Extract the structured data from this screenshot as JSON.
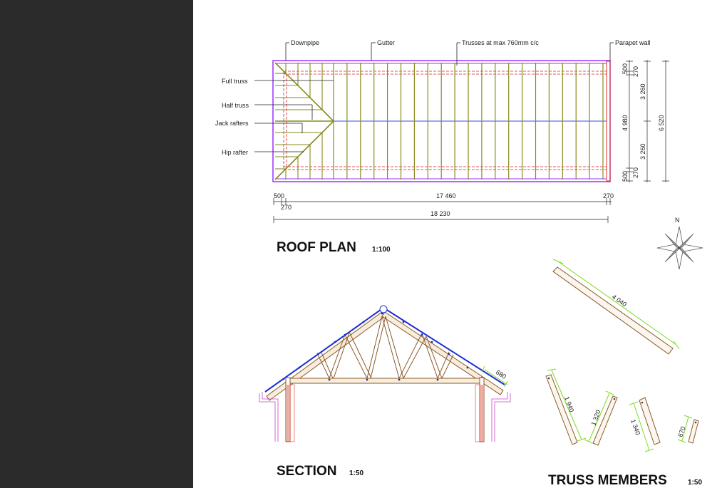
{
  "colors": {
    "background": "#2b2b2b",
    "sheet": "#ffffff",
    "truss": "#8a8a1e",
    "timber": "#8b5a2b",
    "outline": "#9b30ff",
    "dashed": "#d62020",
    "ridge": "#3050e0",
    "dimension_green": "#7ddc1f",
    "roof_blue": "#1a2fd6"
  },
  "roof_plan": {
    "title": "ROOF PLAN",
    "scale": "1:100",
    "callouts": {
      "downpipe": "Downpipe",
      "gutter": "Gutter",
      "trusses": "Trusses at max 760mm c/c",
      "parapet": "Parapet wall",
      "full_truss": "Full truss",
      "half_truss": "Half truss",
      "jack_rafters": "Jack rafters",
      "hip_rafter": "Hip rafter"
    },
    "dimensions": {
      "bottom_500": "500",
      "bottom_270_left": "270",
      "bottom_17460": "17 460",
      "bottom_270_right": "270",
      "overall_18230": "18 230",
      "right_500_top": "500",
      "right_270_top": "270",
      "right_3260_top": "3 260",
      "right_4980": "4 980",
      "right_3260_bottom": "3 260",
      "right_270_bottom": "270",
      "right_500_bottom": "500",
      "right_6520": "6 520"
    }
  },
  "compass": {
    "north": "N"
  },
  "section": {
    "title": "SECTION",
    "scale": "1:50",
    "dim_680": "680"
  },
  "truss_members": {
    "title": "TRUSS MEMBERS",
    "scale": "1:50",
    "lengths": {
      "long": "4 040",
      "m1940": "1 940",
      "m1320": "1 320",
      "m1340": "1 340",
      "m670": "670"
    }
  }
}
